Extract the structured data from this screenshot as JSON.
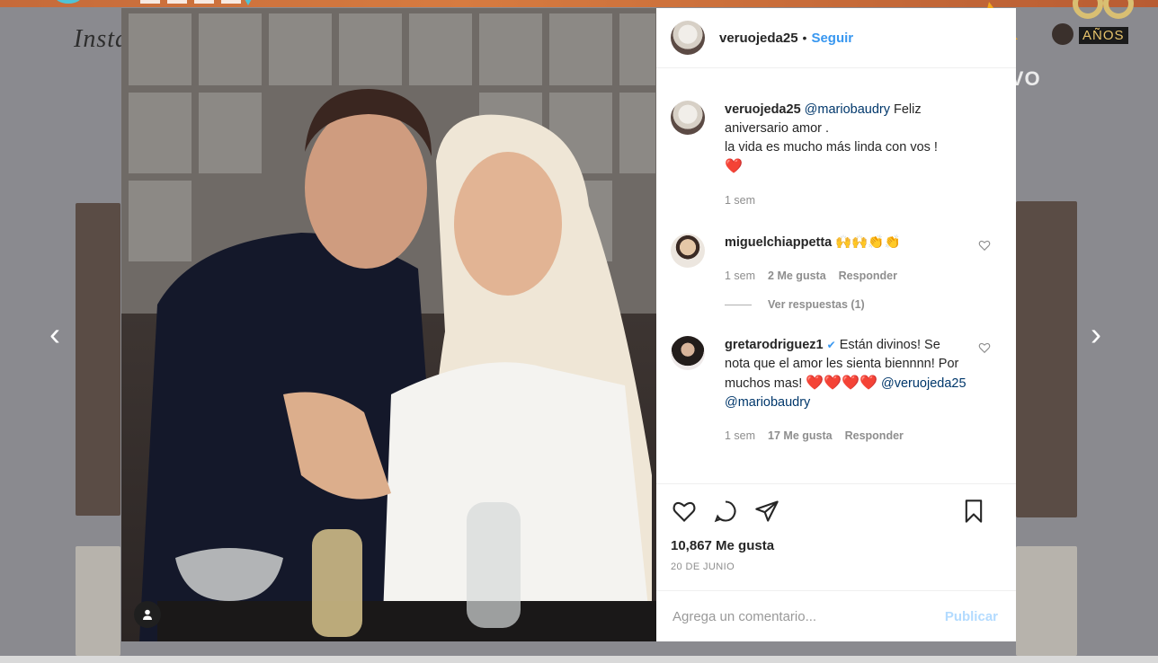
{
  "background": {
    "header_word": "Insta",
    "live_label": "VIVO",
    "anniversary_label": "AÑOS"
  },
  "nav": {
    "prev_glyph": "‹",
    "next_glyph": "›"
  },
  "post": {
    "author": {
      "handle": "veruojeda25",
      "dot": "•",
      "follow_label": "Seguir"
    },
    "caption": {
      "handle": "veruojeda25",
      "mention": "@mariobaudry",
      "text_line1": "Feliz aniversario amor .",
      "text_line2": "la vida es mucho más linda con vos !",
      "emoji": "❤️",
      "time": "1 sem"
    },
    "comments": [
      {
        "handle": "miguelchiappetta",
        "text": "🙌🙌👏👏",
        "time": "1 sem",
        "likes": "2 Me gusta",
        "reply_label": "Responder"
      },
      {
        "handle": "gretarodriguez1",
        "verified": "✔",
        "text": "Están divinos! Se nota que el amor les sienta biennnn! Por muchos mas!",
        "hearts": "❤️❤️❤️❤️",
        "mention1": "@veruojeda25",
        "mention2": "@mariobaudry",
        "time": "1 sem",
        "likes": "17 Me gusta",
        "reply_label": "Responder"
      }
    ],
    "view_replies": "Ver respuestas (1)",
    "likes_count": "10,867 Me gusta",
    "date": "20 DE JUNIO",
    "comment_placeholder": "Agrega un comentario...",
    "publish_label": "Publicar"
  },
  "colors": {
    "follow_blue": "#3897f0",
    "mention_blue": "#00376b",
    "heart_red": "#e01e2d"
  },
  "icons": [
    "heart-icon",
    "comment-icon",
    "share-icon",
    "bookmark-icon",
    "user-tag-icon",
    "verified-badge-icon",
    "chevron-left-icon",
    "chevron-right-icon"
  ]
}
